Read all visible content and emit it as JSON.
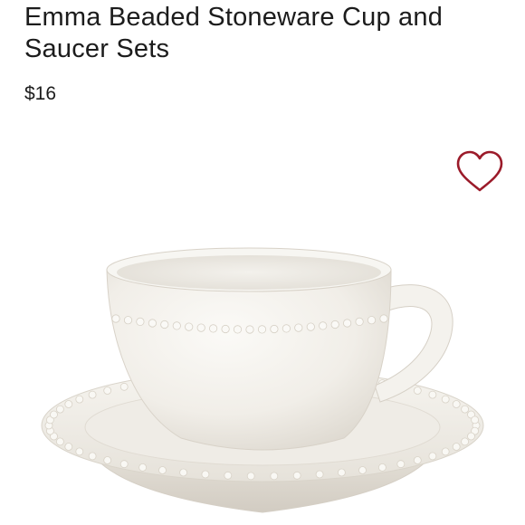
{
  "product": {
    "title": "Emma Beaded Stoneware Cup and Saucer Sets",
    "price": "$16"
  },
  "favorite": {
    "icon": "heart-outline-icon",
    "color": "#9b1b2a"
  },
  "image": {
    "subject": "white beaded stoneware cup and saucer"
  }
}
